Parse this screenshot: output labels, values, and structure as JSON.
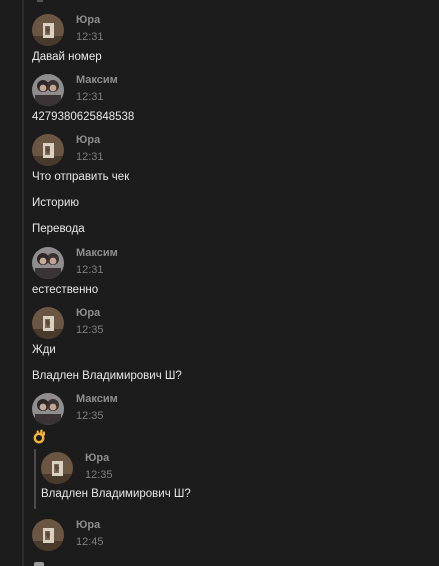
{
  "messages": [
    {
      "author": "Юра",
      "time": "12:31",
      "avatar": "avatar-yura",
      "lines": [
        "Давай номер"
      ]
    },
    {
      "author": "Максим",
      "time": "12:31",
      "avatar": "avatar-maksim",
      "lines": [
        "4279380625848538"
      ]
    },
    {
      "author": "Юра",
      "time": "12:31",
      "avatar": "avatar-yura",
      "lines": [
        "Что отправить чек",
        "Историю",
        "Перевода"
      ]
    },
    {
      "author": "Максим",
      "time": "12:31",
      "avatar": "avatar-maksim",
      "lines": [
        "естественно"
      ]
    },
    {
      "author": "Юра",
      "time": "12:35",
      "avatar": "avatar-yura",
      "lines": [
        "Жди",
        "Владлен Владимирович Ш?"
      ]
    },
    {
      "author": "Максим",
      "time": "12:35",
      "avatar": "avatar-maksim",
      "emoji": "ok-hand-emoji"
    },
    {
      "author": "Юра",
      "time": "12:45",
      "avatar": "avatar-yura",
      "lines": []
    }
  ],
  "quoted_message": {
    "author": "Юра",
    "time": "12:35",
    "avatar": "avatar-yura",
    "text": "Владлен Владимирович Ш?"
  },
  "colors": {
    "background": "#1c1c1c",
    "text": "#e8e8e8",
    "author": "#8e8e8e",
    "time": "#7f7f7f",
    "quote_bar": "#4b4b4b"
  }
}
